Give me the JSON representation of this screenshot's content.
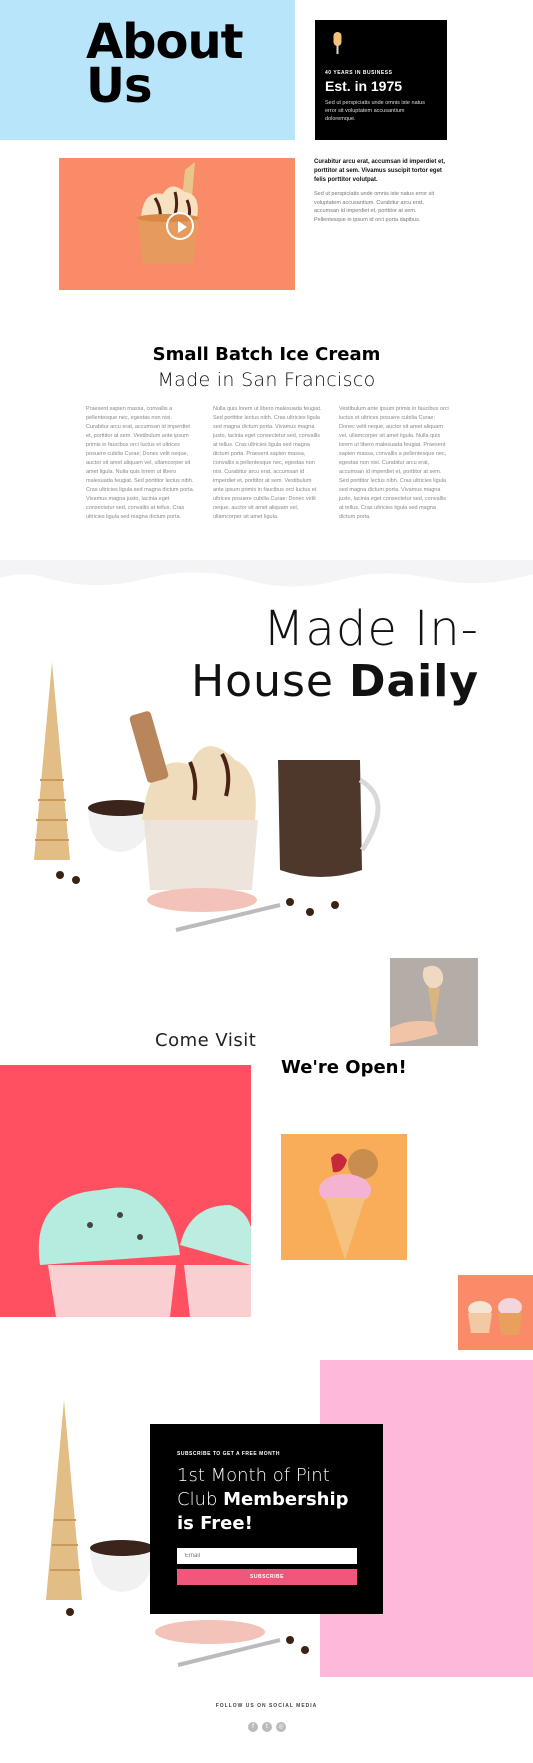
{
  "hero": {
    "title_line1": "About",
    "title_line2": "Us"
  },
  "business": {
    "kicker": "40 YEARS IN BUSINESS",
    "heading": "Est. in 1975",
    "text": "Sed ut perspiciatis unde omnis iste natus error sit voluptatem accusantium doloremque."
  },
  "intro": {
    "bold": "Curabitur arcu erat, accumsan id imperdiet et, porttitor at sem. Vivamus suscipit tortor eget felis porttitor volutpat.",
    "text": "Sed ut perspiciatis unde omnis iste natus error sit voluptatem accusantium. Curabitur arcu erat, accumsan id imperdiet et, porttitor at sem. Pellentesque in ipsum id orci porta dapibus."
  },
  "small_batch": {
    "title": "Small Batch Ice Cream",
    "subtitle": "Made in San Francisco"
  },
  "columns": [
    "Praesent sapien massa, convallis a pellentesque nec, egestas non nisi. Curabitur arcu erat, accumsan id imperdiet et, porttitor at sem. Vestibulum ante ipsum primis in faucibus orci luctus et ultrices posuere cubilia Curae; Donec velit neque, auctor sit amet aliquam vel, ullamcorper sit amet ligula. Nulla quis lorem ut libero malesuada feugiat. Sed porttitor lectus nibh. Cras ultricies ligula sed magna dictum porta. Vivamus magna justo, lacinia eget consectetur sed, convallis at tellus. Cras ultricies ligula sed magna dictum porta.",
    "Nulla quis lorem ut libero malesuada feugiat. Sed porttitor lectus nibh. Cras ultricies ligula sed magna dictum porta. Vivamus magna justo, lacinia eget consectetur sed, convallis at tellus. Cras ultricies ligula sed magna dictum porta. Praesent sapien massa, convallis a pellentesque nec, egestas non nisi. Curabitur arcu erat, accumsan id imperdiet et, porttitor at sem. Vestibulum ante ipsum primis in faucibus orci luctus et ultrices posuere cubilia Curae; Donec velit neque, auctor sit amet aliquam vel, ullamcorper sit amet ligula.",
    "Vestibulum ante ipsum primis in faucibus orci luctus et ultrices posuere cubilia Curae; Donec velit neque, auctor sit amet aliquam vel, ullamcorper sit amet ligula. Nulla quis lorem ut libero malesuada feugiat. Praesent sapien massa, convallis a pellentesque nec, egestas non nisi. Curabitur arcu erat, accumsan id imperdiet et, porttitor at sem. Sed porttitor lectus nibh. Cras ultricies ligula sed magna dictum porta. Vivamus magna justo, lacinia eget consectetur sed, convallis at tellus. Cras ultricies ligula sed magna dictum porta."
  ],
  "made": {
    "line1": "Made In-",
    "line2_light": "House ",
    "line2_bold": "Daily"
  },
  "visit": {
    "come": "Come Visit",
    "open": "We're Open!"
  },
  "signup": {
    "kicker": "SUBSCRIBE TO GET A FREE MONTH",
    "title_light": "1st Month of Pint Club ",
    "title_bold": "Membership is Free!",
    "email_placeholder": "Email",
    "button": "SUBSCRIBE"
  },
  "footer": {
    "follow": "FOLLOW US ON SOCIAL MEDIA"
  },
  "social_icons": [
    "facebook-icon",
    "twitter-icon",
    "instagram-icon"
  ],
  "colors": {
    "hero_blue": "#b9e5fb",
    "coral": "#f98b68",
    "pink": "#fdb8da",
    "subscribe_button": "#f0577a",
    "red": "#fe5060",
    "orange": "#f9ad58"
  }
}
